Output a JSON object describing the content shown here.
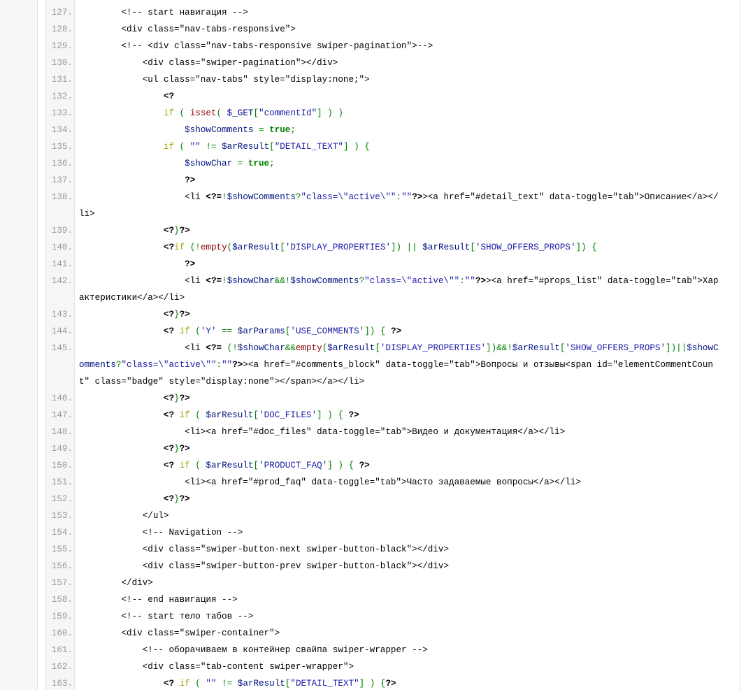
{
  "code": {
    "lines": [
      {
        "n": "127.",
        "indent": 2,
        "tokens": [
          [
            "c",
            "<!-- start навигация -->"
          ]
        ]
      },
      {
        "n": "128.",
        "indent": 2,
        "tokens": [
          [
            "t",
            "<div class=\"nav-tabs-responsive\">"
          ]
        ]
      },
      {
        "n": "129.",
        "indent": 2,
        "tokens": [
          [
            "c",
            "<!-- <div class=\"nav-tabs-responsive swiper-pagination\">-->"
          ]
        ]
      },
      {
        "n": "130.",
        "indent": 3,
        "tokens": [
          [
            "t",
            "<div class=\"swiper-pagination\"></div>"
          ]
        ]
      },
      {
        "n": "131.",
        "indent": 3,
        "tokens": [
          [
            "t",
            "<ul class=\"nav-tabs\" style=\"display:none;\">"
          ]
        ]
      },
      {
        "n": "132.",
        "indent": 4,
        "tokens": [
          [
            "p",
            "<?"
          ]
        ]
      },
      {
        "n": "133.",
        "indent": 4,
        "tokens": [
          [
            "k",
            "if"
          ],
          [
            "t",
            " "
          ],
          [
            "o",
            "("
          ],
          [
            "t",
            " "
          ],
          [
            "f",
            "isset"
          ],
          [
            "o",
            "("
          ],
          [
            "t",
            " "
          ],
          [
            "v",
            "$_GET"
          ],
          [
            "o",
            "["
          ],
          [
            "s",
            "\"commentId\""
          ],
          [
            "o",
            "]"
          ],
          [
            "t",
            " "
          ],
          [
            "o",
            ")"
          ],
          [
            "t",
            " "
          ],
          [
            "o",
            ")"
          ]
        ]
      },
      {
        "n": "134.",
        "indent": 5,
        "tokens": [
          [
            "v",
            "$showComments"
          ],
          [
            "t",
            " "
          ],
          [
            "o",
            "="
          ],
          [
            "t",
            " "
          ],
          [
            "b",
            "true"
          ],
          [
            "o",
            ";"
          ]
        ]
      },
      {
        "n": "135.",
        "indent": 4,
        "tokens": [
          [
            "k",
            "if"
          ],
          [
            "t",
            " "
          ],
          [
            "o",
            "("
          ],
          [
            "t",
            " "
          ],
          [
            "s",
            "\"\""
          ],
          [
            "t",
            " "
          ],
          [
            "o",
            "!="
          ],
          [
            "t",
            " "
          ],
          [
            "v",
            "$arResult"
          ],
          [
            "o",
            "["
          ],
          [
            "s",
            "\"DETAIL_TEXT\""
          ],
          [
            "o",
            "]"
          ],
          [
            "t",
            " "
          ],
          [
            "o",
            ")"
          ],
          [
            "t",
            " "
          ],
          [
            "o",
            "{"
          ]
        ]
      },
      {
        "n": "136.",
        "indent": 5,
        "tokens": [
          [
            "v",
            "$showChar"
          ],
          [
            "t",
            " "
          ],
          [
            "o",
            "="
          ],
          [
            "t",
            " "
          ],
          [
            "b",
            "true"
          ],
          [
            "o",
            ";"
          ]
        ]
      },
      {
        "n": "137.",
        "indent": 5,
        "tokens": [
          [
            "p",
            "?>"
          ]
        ]
      },
      {
        "n": "138.",
        "indent": 5,
        "tokens": [
          [
            "t",
            "<li "
          ],
          [
            "p",
            "<?="
          ],
          [
            "o",
            "!"
          ],
          [
            "v",
            "$showComments"
          ],
          [
            "o",
            "?"
          ],
          [
            "s",
            "\"class=\\\"active\\\"\""
          ],
          [
            "o",
            ":"
          ],
          [
            "s",
            "\"\""
          ],
          [
            "p",
            "?>"
          ],
          [
            "t",
            "><a href=\"#detail_text\" data-toggle=\"tab\">Описание</a></li>"
          ]
        ]
      },
      {
        "n": "139.",
        "indent": 4,
        "tokens": [
          [
            "p",
            "<?"
          ],
          [
            "o",
            "}"
          ],
          [
            "p",
            "?>"
          ]
        ]
      },
      {
        "n": "140.",
        "indent": 4,
        "tokens": [
          [
            "p",
            "<?"
          ],
          [
            "k",
            "if"
          ],
          [
            "t",
            " "
          ],
          [
            "o",
            "(!"
          ],
          [
            "f",
            "empty"
          ],
          [
            "o",
            "("
          ],
          [
            "v",
            "$arResult"
          ],
          [
            "o",
            "["
          ],
          [
            "sq",
            "'DISPLAY_PROPERTIES'"
          ],
          [
            "o",
            "])"
          ],
          [
            "t",
            " "
          ],
          [
            "o",
            "||"
          ],
          [
            "t",
            " "
          ],
          [
            "v",
            "$arResult"
          ],
          [
            "o",
            "["
          ],
          [
            "sq",
            "'SHOW_OFFERS_PROPS'"
          ],
          [
            "o",
            "])"
          ],
          [
            "t",
            " "
          ],
          [
            "o",
            "{"
          ]
        ]
      },
      {
        "n": "141.",
        "indent": 5,
        "tokens": [
          [
            "p",
            "?>"
          ]
        ]
      },
      {
        "n": "142.",
        "indent": 5,
        "tokens": [
          [
            "t",
            "<li "
          ],
          [
            "p",
            "<?="
          ],
          [
            "o",
            "!"
          ],
          [
            "v",
            "$showChar"
          ],
          [
            "o",
            "&&!"
          ],
          [
            "v",
            "$showComments"
          ],
          [
            "o",
            "?"
          ],
          [
            "s",
            "\"class=\\\"active\\\"\""
          ],
          [
            "o",
            ":"
          ],
          [
            "s",
            "\"\""
          ],
          [
            "p",
            "?>"
          ],
          [
            "t",
            "><a href=\"#props_list\" data-toggle=\"tab\">Характеристики</a></li>"
          ]
        ]
      },
      {
        "n": "143.",
        "indent": 4,
        "tokens": [
          [
            "p",
            "<?"
          ],
          [
            "o",
            "}"
          ],
          [
            "p",
            "?>"
          ]
        ]
      },
      {
        "n": "144.",
        "indent": 4,
        "tokens": [
          [
            "p",
            "<?"
          ],
          [
            "t",
            " "
          ],
          [
            "k",
            "if"
          ],
          [
            "t",
            " "
          ],
          [
            "o",
            "("
          ],
          [
            "sq",
            "'Y'"
          ],
          [
            "t",
            " "
          ],
          [
            "o",
            "=="
          ],
          [
            "t",
            " "
          ],
          [
            "v",
            "$arParams"
          ],
          [
            "o",
            "["
          ],
          [
            "sq",
            "'USE_COMMENTS'"
          ],
          [
            "o",
            "])"
          ],
          [
            "t",
            " "
          ],
          [
            "o",
            "{"
          ],
          [
            "t",
            " "
          ],
          [
            "p",
            "?>"
          ]
        ]
      },
      {
        "n": "145.",
        "indent": 5,
        "tokens": [
          [
            "t",
            "<li "
          ],
          [
            "p",
            "<?="
          ],
          [
            "t",
            " "
          ],
          [
            "o",
            "(!"
          ],
          [
            "v",
            "$showChar"
          ],
          [
            "o",
            "&&"
          ],
          [
            "f",
            "empty"
          ],
          [
            "o",
            "("
          ],
          [
            "v",
            "$arResult"
          ],
          [
            "o",
            "["
          ],
          [
            "sq",
            "'DISPLAY_PROPERTIES'"
          ],
          [
            "o",
            "])&&!"
          ],
          [
            "v",
            "$arResult"
          ],
          [
            "o",
            "["
          ],
          [
            "sq",
            "'SHOW_OFFERS_PROPS'"
          ],
          [
            "o",
            "])||"
          ],
          [
            "v",
            "$showComments"
          ],
          [
            "o",
            "?"
          ],
          [
            "s",
            "\"class=\\\"active\\\"\""
          ],
          [
            "o",
            ":"
          ],
          [
            "s",
            "\"\""
          ],
          [
            "p",
            "?>"
          ],
          [
            "t",
            "><a href=\"#comments_block\" data-toggle=\"tab\">Вопросы и отзывы<span id=\"elementCommentCount\" class=\"badge\" style=\"display:none\"></span></a></li>"
          ]
        ]
      },
      {
        "n": "146.",
        "indent": 4,
        "tokens": [
          [
            "p",
            "<?"
          ],
          [
            "o",
            "}"
          ],
          [
            "p",
            "?>"
          ]
        ]
      },
      {
        "n": "147.",
        "indent": 4,
        "tokens": [
          [
            "p",
            "<?"
          ],
          [
            "t",
            " "
          ],
          [
            "k",
            "if"
          ],
          [
            "t",
            " "
          ],
          [
            "o",
            "("
          ],
          [
            "t",
            " "
          ],
          [
            "v",
            "$arResult"
          ],
          [
            "o",
            "["
          ],
          [
            "sq",
            "'DOC_FILES'"
          ],
          [
            "o",
            "]"
          ],
          [
            "t",
            " "
          ],
          [
            "o",
            ")"
          ],
          [
            "t",
            " "
          ],
          [
            "o",
            "{"
          ],
          [
            "t",
            " "
          ],
          [
            "p",
            "?>"
          ]
        ]
      },
      {
        "n": "148.",
        "indent": 5,
        "tokens": [
          [
            "t",
            "<li><a href=\"#doc_files\" data-toggle=\"tab\">Видео и документация</a></li>"
          ]
        ]
      },
      {
        "n": "149.",
        "indent": 4,
        "tokens": [
          [
            "p",
            "<?"
          ],
          [
            "o",
            "}"
          ],
          [
            "p",
            "?>"
          ]
        ]
      },
      {
        "n": "150.",
        "indent": 4,
        "tokens": [
          [
            "p",
            "<?"
          ],
          [
            "t",
            " "
          ],
          [
            "k",
            "if"
          ],
          [
            "t",
            " "
          ],
          [
            "o",
            "("
          ],
          [
            "t",
            " "
          ],
          [
            "v",
            "$arResult"
          ],
          [
            "o",
            "["
          ],
          [
            "sq",
            "'PRODUCT_FAQ'"
          ],
          [
            "o",
            "]"
          ],
          [
            "t",
            " "
          ],
          [
            "o",
            ")"
          ],
          [
            "t",
            " "
          ],
          [
            "o",
            "{"
          ],
          [
            "t",
            " "
          ],
          [
            "p",
            "?>"
          ]
        ]
      },
      {
        "n": "151.",
        "indent": 5,
        "tokens": [
          [
            "t",
            "<li><a href=\"#prod_faq\" data-toggle=\"tab\">Часто задаваемые вопросы</a></li>"
          ]
        ]
      },
      {
        "n": "152.",
        "indent": 4,
        "tokens": [
          [
            "p",
            "<?"
          ],
          [
            "o",
            "}"
          ],
          [
            "p",
            "?>"
          ]
        ]
      },
      {
        "n": "153.",
        "indent": 3,
        "tokens": [
          [
            "t",
            "</ul>"
          ]
        ]
      },
      {
        "n": "154.",
        "indent": 3,
        "tokens": [
          [
            "c",
            "<!-- Navigation -->"
          ]
        ]
      },
      {
        "n": "155.",
        "indent": 3,
        "tokens": [
          [
            "t",
            "<div class=\"swiper-button-next swiper-button-black\"></div>"
          ]
        ]
      },
      {
        "n": "156.",
        "indent": 3,
        "tokens": [
          [
            "t",
            "<div class=\"swiper-button-prev swiper-button-black\"></div>"
          ]
        ]
      },
      {
        "n": "157.",
        "indent": 2,
        "tokens": [
          [
            "t",
            "</div>"
          ]
        ]
      },
      {
        "n": "158.",
        "indent": 2,
        "tokens": [
          [
            "c",
            "<!-- end навигация -->"
          ]
        ]
      },
      {
        "n": "159.",
        "indent": 2,
        "tokens": [
          [
            "c",
            "<!-- start тело табов -->"
          ]
        ]
      },
      {
        "n": "160.",
        "indent": 2,
        "tokens": [
          [
            "t",
            "<div class=\"swiper-container\">"
          ]
        ]
      },
      {
        "n": "161.",
        "indent": 3,
        "tokens": [
          [
            "c",
            "<!-- оборачиваем в контейнер свайпа swiper-wrapper -->"
          ]
        ]
      },
      {
        "n": "162.",
        "indent": 3,
        "tokens": [
          [
            "t",
            "<div class=\"tab-content swiper-wrapper\">"
          ]
        ]
      },
      {
        "n": "163.",
        "indent": 4,
        "tokens": [
          [
            "p",
            "<?"
          ],
          [
            "t",
            " "
          ],
          [
            "k",
            "if"
          ],
          [
            "t",
            " "
          ],
          [
            "o",
            "("
          ],
          [
            "t",
            " "
          ],
          [
            "s",
            "\"\""
          ],
          [
            "t",
            " "
          ],
          [
            "o",
            "!="
          ],
          [
            "t",
            " "
          ],
          [
            "v",
            "$arResult"
          ],
          [
            "o",
            "["
          ],
          [
            "s",
            "\"DETAIL_TEXT\""
          ],
          [
            "o",
            "]"
          ],
          [
            "t",
            " "
          ],
          [
            "o",
            ")"
          ],
          [
            "t",
            " "
          ],
          [
            "o",
            "{"
          ],
          [
            "p",
            "?>"
          ]
        ]
      }
    ]
  }
}
